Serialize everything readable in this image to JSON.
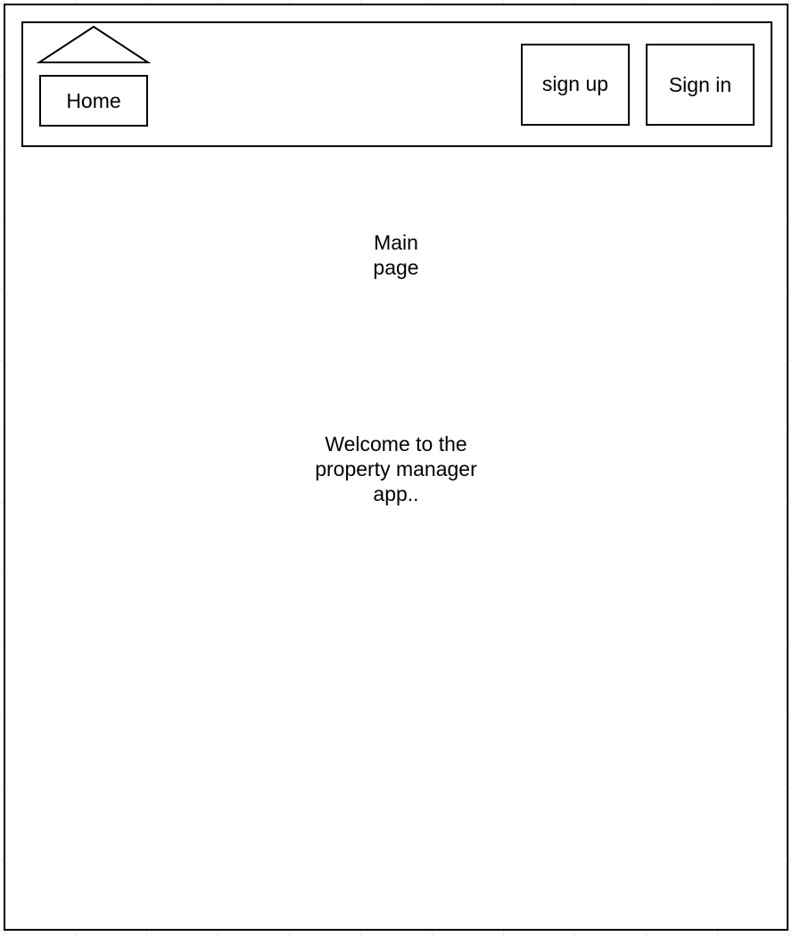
{
  "header": {
    "home_icon": "house-roof-icon",
    "home_label": "Home",
    "signup_label": "sign up",
    "signin_label": "Sign in"
  },
  "main": {
    "title": "Main\npage",
    "welcome": "Welcome to the\nproperty manager\napp.."
  },
  "colors": {
    "stroke": "#000000",
    "background": "#ffffff",
    "grid": "#ececec"
  }
}
